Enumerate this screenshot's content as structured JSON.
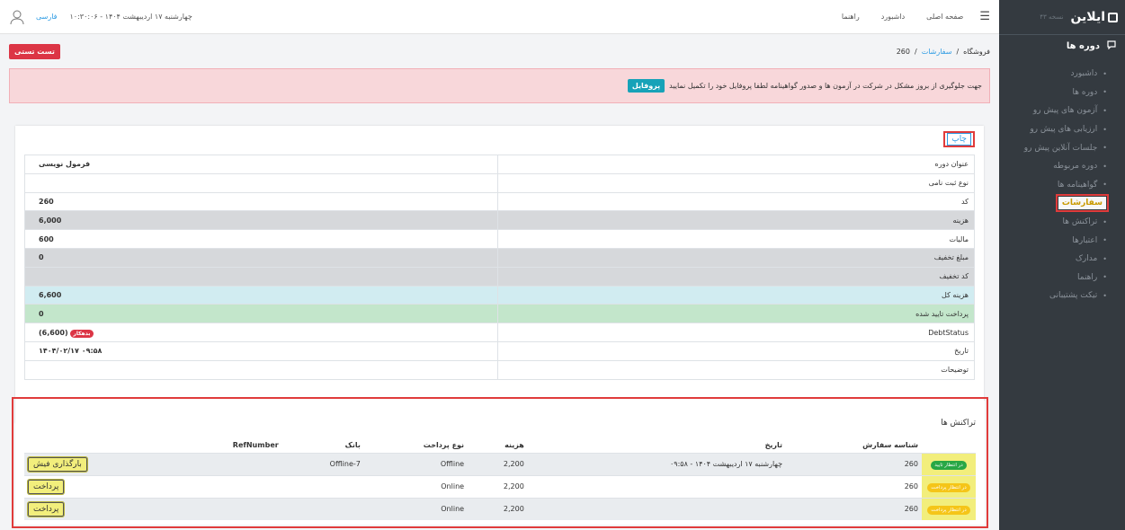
{
  "sidebar": {
    "logo": "ایلاین",
    "version": "نسخه ۴۳",
    "title": "دوره ها",
    "items": [
      {
        "label": "داشبورد"
      },
      {
        "label": "دوره ها"
      },
      {
        "label": "آزمون های پیش رو"
      },
      {
        "label": "ارزیابی های پیش رو"
      },
      {
        "label": "جلسات آنلاین پیش رو"
      },
      {
        "label": "دوره مربوطه"
      },
      {
        "label": "گواهینامه ها"
      },
      {
        "label": "سفارشات",
        "active": true
      },
      {
        "label": "تراکنش ها"
      },
      {
        "label": "اعتبارها"
      },
      {
        "label": "مدارک"
      },
      {
        "label": "راهنما"
      },
      {
        "label": "تیکت پشتیبانی"
      }
    ]
  },
  "topbar": {
    "home": "صفحه اصلی",
    "dashboard": "داشبورد",
    "help": "راهنما",
    "language": "فارسی",
    "datetime": "چهارشنبه ۱۷ اردیبهشت ۱۴۰۴ - ۱۰:۳۰:۰۶"
  },
  "breadcrumb": {
    "store": "فروشگاه",
    "orders": "سفارشات",
    "current": "260",
    "sep": "/"
  },
  "test_button": "تست تستی",
  "alert": {
    "text": "جهت جلوگیری از بروز مشکل در شرکت در آزمون ها و صدور گواهینامه لطفا پروفایل خود را تکمیل نمایید",
    "button": "پروفایل"
  },
  "order": {
    "print": "چاپ",
    "rows": [
      {
        "label": "عنوان دوره",
        "value": "فرمول نویسی"
      },
      {
        "label": "نوع ثبت نامی",
        "value": ""
      },
      {
        "label": "کد",
        "value": "260"
      },
      {
        "label": "هزینه",
        "value": "6,000"
      },
      {
        "label": "مالیات",
        "value": "600"
      },
      {
        "label": "مبلغ تخفیف",
        "value": "0"
      },
      {
        "label": "کد تخفیف",
        "value": ""
      },
      {
        "label": "هزینه کل",
        "value": "6,600"
      },
      {
        "label": "پرداخت تایید شده",
        "value": "0"
      },
      {
        "label": "DebtStatus",
        "value": "(6,600)",
        "badge": "بدهکار"
      },
      {
        "label": "تاریخ",
        "value": "۰۹:۵۸ ۱۴۰۴/۰۲/۱۷"
      },
      {
        "label": "توضیحات",
        "value": ""
      }
    ]
  },
  "transactions": {
    "title": "تراکنش ها",
    "headers": {
      "order_id": "شناسه سفارش",
      "date": "تاریخ",
      "cost": "هزینه",
      "pay_type": "نوع پرداخت",
      "bank": "بانک",
      "ref": "RefNumber"
    },
    "rows": [
      {
        "status": "در انتظار تایید",
        "order_id": "260",
        "date": "چهارشنبه ۱۷ اردیبهشت ۱۴۰۴ - ۰۹:۵۸",
        "cost": "2,200",
        "pay_type": "Offline",
        "bank": "Offline-7",
        "ref": "",
        "action": "بارگذاری فیش"
      },
      {
        "status": "در انتظار پرداخت",
        "order_id": "260",
        "date": "",
        "cost": "2,200",
        "pay_type": "Online",
        "bank": "",
        "ref": "",
        "action": "پرداخت"
      },
      {
        "status": "در انتظار پرداخت",
        "order_id": "260",
        "date": "",
        "cost": "2,200",
        "pay_type": "Online",
        "bank": "",
        "ref": "",
        "action": "پرداخت"
      }
    ]
  }
}
